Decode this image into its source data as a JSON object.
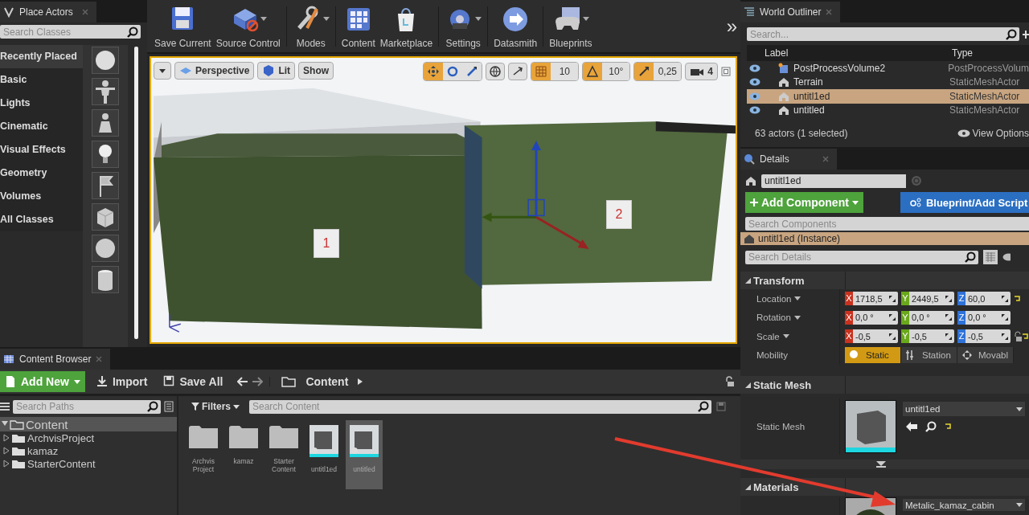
{
  "place_actors": {
    "title": "Place Actors",
    "search": {
      "placeholder": "Search Classes"
    },
    "categories": [
      {
        "label": "Recently Placed",
        "selected": true
      },
      {
        "label": "Basic",
        "selected": false
      },
      {
        "label": "Lights",
        "selected": false
      },
      {
        "label": "Cinematic",
        "selected": false
      },
      {
        "label": "Visual Effects",
        "selected": false
      },
      {
        "label": "Geometry",
        "selected": false
      },
      {
        "label": "Volumes",
        "selected": false
      },
      {
        "label": "All Classes",
        "selected": false
      }
    ]
  },
  "toolbar": {
    "buttons": [
      {
        "label": "Save Current",
        "dropdown": false
      },
      {
        "label": "Source Control",
        "dropdown": true
      },
      {
        "label": "Modes",
        "dropdown": true
      },
      {
        "label": "Content",
        "dropdown": false
      },
      {
        "label": "Marketplace",
        "dropdown": false
      },
      {
        "label": "Settings",
        "dropdown": true
      },
      {
        "label": "Datasmith",
        "dropdown": false
      },
      {
        "label": "Blueprints",
        "dropdown": true
      }
    ],
    "overflow": "»"
  },
  "viewport": {
    "view_buttons": [
      {
        "label": "Perspective"
      },
      {
        "label": "Lit"
      },
      {
        "label": "Show"
      }
    ],
    "transform_modes": [
      {
        "selected": true
      },
      {
        "selected": false
      },
      {
        "selected": false
      }
    ],
    "snaps": [
      {
        "label": "10",
        "on": true
      },
      {
        "label": "10°",
        "on": true
      },
      {
        "label": "0,25",
        "on": true
      }
    ],
    "camera_speed": "4",
    "markers": [
      {
        "label": "1"
      },
      {
        "label": "2"
      }
    ]
  },
  "content_browser": {
    "title": "Content Browser",
    "actions": [
      {
        "label": "Add New",
        "kind": "add"
      },
      {
        "label": "Import",
        "kind": "import"
      },
      {
        "label": "Save All",
        "kind": "save"
      }
    ],
    "path": "Content",
    "search_paths": {
      "placeholder": "Search Paths"
    },
    "tree": [
      {
        "label": "Content",
        "expanded": true,
        "selected": true,
        "children": [
          {
            "label": "ArchvisProject",
            "expanded": false,
            "selected": false
          },
          {
            "label": "kamaz",
            "expanded": false,
            "selected": false
          },
          {
            "label": "StarterContent",
            "expanded": false,
            "selected": false
          }
        ]
      }
    ],
    "filters": "Filters",
    "search_content": {
      "placeholder": "Search Content"
    },
    "assets": [
      {
        "label": "Archvis Project",
        "kind": "folder",
        "selected": false
      },
      {
        "label": "kamaz",
        "kind": "folder",
        "selected": false
      },
      {
        "label": "Starter Content",
        "kind": "folder",
        "selected": false
      },
      {
        "label": "untitl1ed",
        "kind": "mesh",
        "selected": false
      },
      {
        "label": "untitled",
        "kind": "mesh",
        "selected": true
      }
    ]
  },
  "outliner": {
    "title": "World Outliner",
    "search": {
      "placeholder": "Search..."
    },
    "columns": [
      "Label",
      "Type"
    ],
    "rows": [
      {
        "label": "PostProcessVolume2",
        "type": "PostProcessVolum",
        "kind": "volume",
        "selected": false
      },
      {
        "label": "Terrain",
        "type": "StaticMeshActor",
        "kind": "mesh",
        "selected": false
      },
      {
        "label": "untitl1ed",
        "type": "StaticMeshActor",
        "kind": "mesh",
        "selected": true
      },
      {
        "label": "untitled",
        "type": "StaticMeshActor",
        "kind": "mesh",
        "selected": false
      }
    ],
    "status": "63 actors (1 selected)",
    "view_options": "View Options"
  },
  "details": {
    "title": "Details",
    "name": "untitl1ed",
    "add_component": "Add Component",
    "blueprint": "Blueprint/Add Script",
    "search_components": {
      "placeholder": "Search Components"
    },
    "instance": "untitl1ed (Instance)",
    "search_details": {
      "placeholder": "Search Details"
    },
    "transform": {
      "title": "Transform",
      "rows": [
        {
          "label": "Location",
          "fields": [
            {
              "axis": "X",
              "value": "1718,5"
            },
            {
              "axis": "Y",
              "value": "2449,5"
            },
            {
              "axis": "Z",
              "value": "60,0"
            }
          ]
        },
        {
          "label": "Rotation",
          "fields": [
            {
              "axis": "X",
              "value": "0,0 °"
            },
            {
              "axis": "Y",
              "value": "0,0 °"
            },
            {
              "axis": "Z",
              "value": "0,0 °"
            }
          ]
        },
        {
          "label": "Scale",
          "fields": [
            {
              "axis": "X",
              "value": "-0,5"
            },
            {
              "axis": "Y",
              "value": "-0,5"
            },
            {
              "axis": "Z",
              "value": "-0,5"
            }
          ]
        }
      ],
      "mobility": {
        "label": "Mobility",
        "options": [
          {
            "label": "Static",
            "selected": true
          },
          {
            "label": "Station",
            "selected": false
          },
          {
            "label": "Movabl",
            "selected": false
          }
        ]
      }
    },
    "static_mesh": {
      "title": "Static Mesh",
      "label": "Static Mesh",
      "asset": "untitl1ed"
    },
    "materials": {
      "title": "Materials",
      "asset": "Metalic_kamaz_cabin"
    }
  }
}
